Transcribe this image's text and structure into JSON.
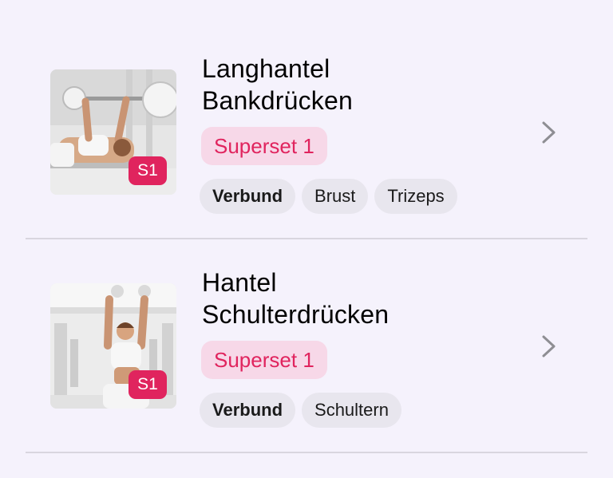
{
  "exercises": [
    {
      "title_line1": "Langhantel",
      "title_line2": "Bankdrücken",
      "superset_label": "Superset",
      "superset_number": "1",
      "badge": "S1",
      "tags": [
        {
          "label": "Verbund",
          "bold": true
        },
        {
          "label": "Brust",
          "bold": false
        },
        {
          "label": "Trizeps",
          "bold": false
        }
      ],
      "icon": "chevron-right-icon"
    },
    {
      "title_line1": "Hantel",
      "title_line2": "Schulterdrücken",
      "superset_label": "Superset",
      "superset_number": "1",
      "badge": "S1",
      "tags": [
        {
          "label": "Verbund",
          "bold": true
        },
        {
          "label": "Schultern",
          "bold": false
        }
      ],
      "icon": "chevron-right-icon"
    }
  ],
  "colors": {
    "background": "#f5f2fc",
    "accent": "#e0245e",
    "superset_bg": "#f7d8e8",
    "chip_bg": "#e8e6ee",
    "chevron": "#8e8e93",
    "divider": "#d9d6df"
  }
}
